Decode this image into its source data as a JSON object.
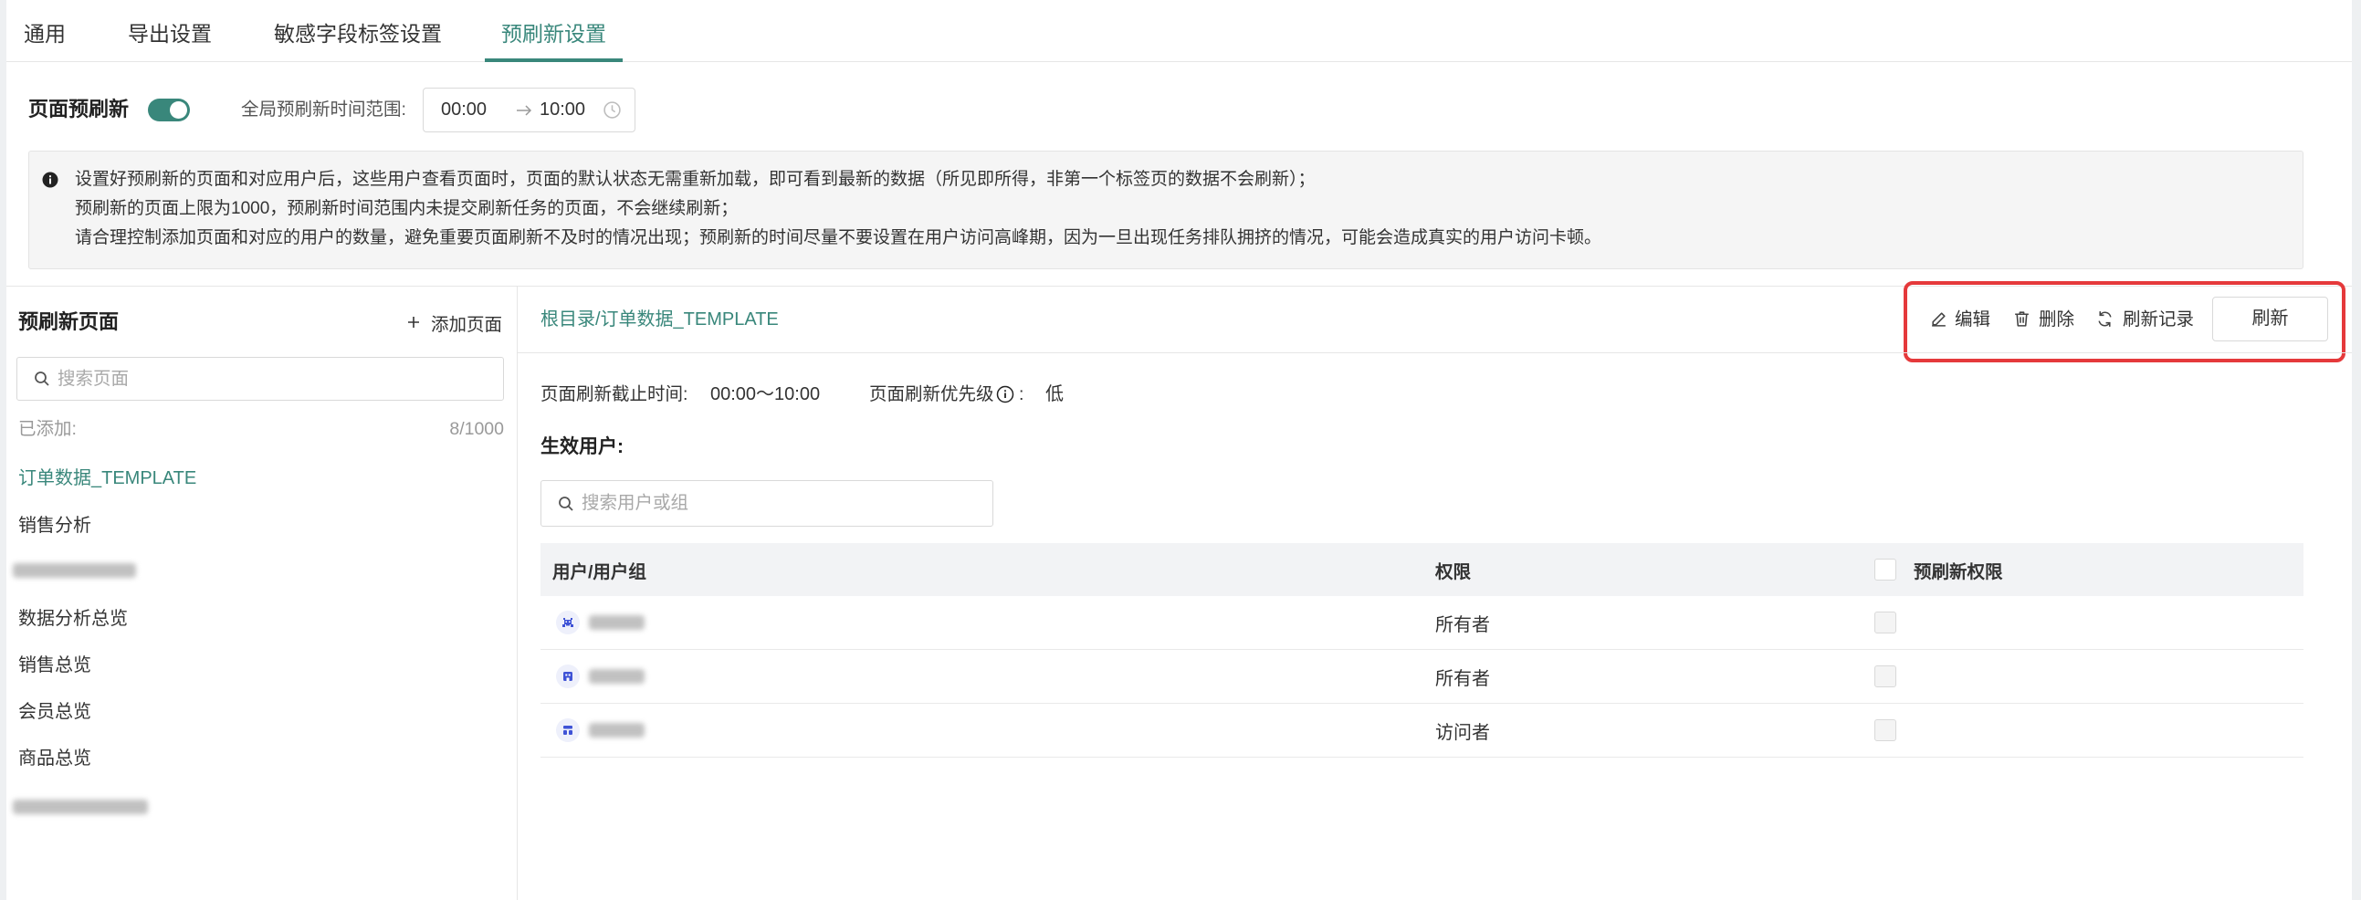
{
  "colors": {
    "primary": "#39877b",
    "highlight": "#e5393b"
  },
  "tabs": [
    {
      "label": "通用"
    },
    {
      "label": "导出设置"
    },
    {
      "label": "敏感字段标签设置"
    },
    {
      "label": "预刷新设置",
      "active": true
    }
  ],
  "prefresh": {
    "label": "页面预刷新",
    "enabled": true,
    "range_label": "全局预刷新时间范围:",
    "start": "00:00",
    "end": "10:00"
  },
  "notice": {
    "lines": [
      "设置好预刷新的页面和对应用户后，这些用户查看页面时，页面的默认状态无需重新加载，即可看到最新的数据（所见即所得，非第一个标签页的数据不会刷新）；",
      "预刷新的页面上限为1000，预刷新时间范围内未提交刷新任务的页面，不会继续刷新；",
      "请合理控制添加页面和对应的用户的数量，避免重要页面刷新不及时的情况出现；预刷新的时间尽量不要设置在用户访问高峰期，因为一旦出现任务排队拥挤的情况，可能会造成真实的用户访问卡顿。"
    ]
  },
  "sidebar": {
    "title": "预刷新页面",
    "add_label": "添加页面",
    "search_placeholder": "搜索页面",
    "added_label": "已添加:",
    "added_count": "8/1000",
    "items": [
      {
        "label": "订单数据_TEMPLATE",
        "selected": true
      },
      {
        "label": "销售分析"
      },
      {
        "blurred": true
      },
      {
        "label": "数据分析总览"
      },
      {
        "label": "销售总览"
      },
      {
        "label": "会员总览"
      },
      {
        "label": "商品总览"
      },
      {
        "blurred": true
      }
    ]
  },
  "main": {
    "breadcrumb": "根目录/订单数据_TEMPLATE",
    "actions": {
      "edit": "编辑",
      "delete": "删除",
      "history": "刷新记录",
      "refresh": "刷新"
    },
    "deadline_label": "页面刷新截止时间:",
    "deadline_value": "00:00～10:00",
    "priority_label": "页面刷新优先级",
    "priority_colon": ":",
    "priority_value": "低",
    "users_title": "生效用户:",
    "user_search_placeholder": "搜索用户或组",
    "table": {
      "headers": {
        "user": "用户/用户组",
        "permission": "权限",
        "prefresh": "预刷新权限"
      },
      "header_checked": false,
      "rows": [
        {
          "icon": "user-group-icon",
          "permission": "所有者",
          "prefresh": false
        },
        {
          "icon": "department-icon",
          "permission": "所有者",
          "prefresh": false
        },
        {
          "icon": "role-icon",
          "permission": "访问者",
          "prefresh": false
        }
      ]
    }
  }
}
